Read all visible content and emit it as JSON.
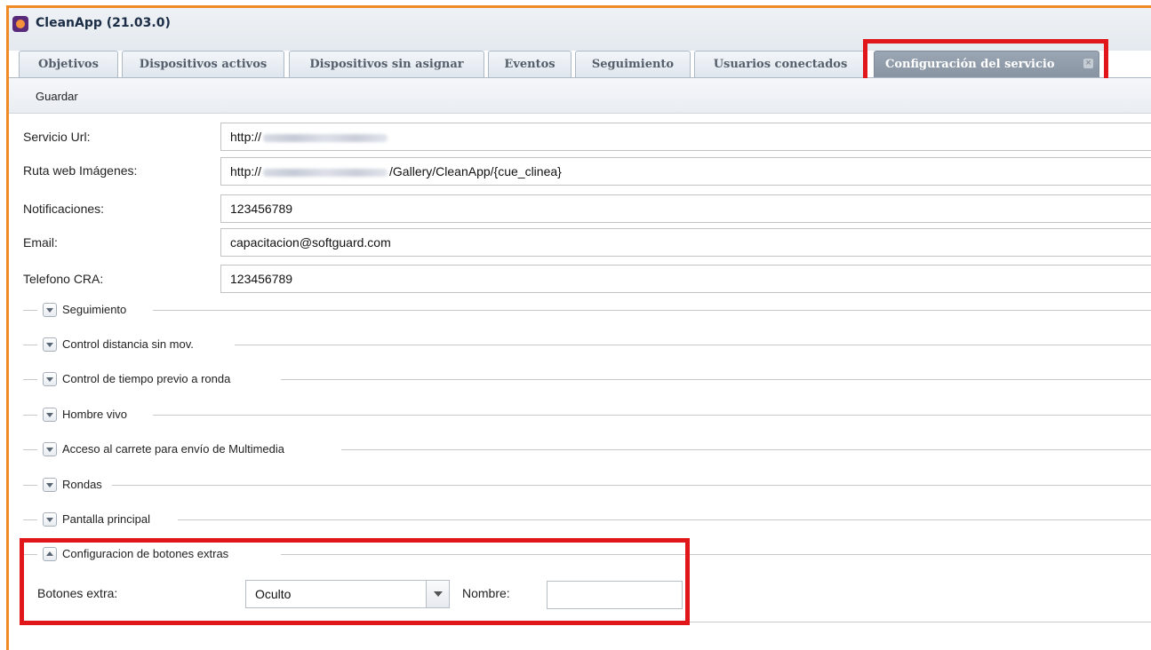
{
  "window": {
    "title": "CleanApp (21.03.0)"
  },
  "tabs": [
    {
      "label": "Objetivos",
      "active": false
    },
    {
      "label": "Dispositivos activos",
      "active": false
    },
    {
      "label": "Dispositivos sin asignar",
      "active": false
    },
    {
      "label": "Eventos",
      "active": false
    },
    {
      "label": "Seguimiento",
      "active": false
    },
    {
      "label": "Usuarios conectados",
      "active": false
    },
    {
      "label": "Configuración del servicio",
      "active": true
    }
  ],
  "toolbar": {
    "save_label": "Guardar"
  },
  "form": {
    "servicio_url": {
      "label": "Servicio Url:",
      "prefix": "http://",
      "suffix": ""
    },
    "ruta_web": {
      "label": "Ruta web Imágenes:",
      "prefix": "http://",
      "suffix": "/Gallery/CleanApp/{cue_clinea}"
    },
    "notificaciones": {
      "label": "Notificaciones:",
      "value": "123456789"
    },
    "email": {
      "label": "Email:",
      "value": "capacitacion@softguard.com"
    },
    "telefono": {
      "label": "Telefono CRA:",
      "value": "123456789"
    }
  },
  "sections": [
    {
      "label": "Seguimiento",
      "expanded": false
    },
    {
      "label": "Control distancia sin mov.",
      "expanded": false
    },
    {
      "label": "Control de tiempo previo a ronda",
      "expanded": false
    },
    {
      "label": "Hombre vivo",
      "expanded": false
    },
    {
      "label": "Acceso al carrete para envío de Multimedia",
      "expanded": false
    },
    {
      "label": "Rondas",
      "expanded": false
    },
    {
      "label": "Pantalla principal",
      "expanded": false
    },
    {
      "label": "Configuracion de botones extras",
      "expanded": true
    }
  ],
  "extras": {
    "botones_label": "Botones extra:",
    "botones_value": "Oculto",
    "nombre_label": "Nombre:",
    "nombre_value": ""
  },
  "colors": {
    "frame": "#f08a24",
    "highlight": "#e0161b",
    "active_tab": "#8f9ba8"
  }
}
